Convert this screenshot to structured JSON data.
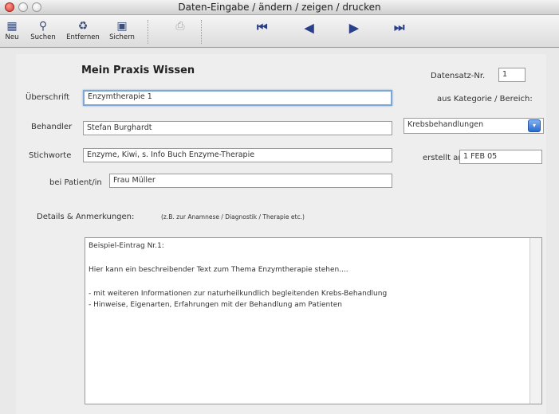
{
  "window": {
    "title": "Daten-Eingabe / ändern / zeigen / drucken"
  },
  "toolbar": {
    "new": "Neu",
    "search": "Suchen",
    "remove": "Entfernen",
    "save": "Sichern"
  },
  "form": {
    "heading": "Mein Praxis Wissen",
    "record_label": "Datensatz-Nr.",
    "record_value": "1",
    "title_label": "Überschrift",
    "title_value": "Enzymtherapie 1",
    "category_label": "aus Kategorie / Bereich:",
    "category_value": "Krebsbehandlungen",
    "practitioner_label": "Behandler",
    "practitioner_value": "Stefan Burghardt",
    "keywords_label": "Stichworte",
    "keywords_value": "Enzyme, Kiwi, s. Info Buch Enzyme-Therapie",
    "created_label": "erstellt am",
    "created_value": "1 FEB 05",
    "patient_label": "bei Patient/in",
    "patient_value": "Frau Müller",
    "details_label": "Details & Anmerkungen:",
    "details_hint": "(z.B. zur Anamnese / Diagnostik / Therapie etc.)",
    "details_lines": [
      "Beispiel-Eintrag  Nr.1:",
      "Hier kann ein beschreibender Text zum Thema Enzymtherapie stehen....",
      "- mit weiteren Informationen zur naturheilkundlich begleitenden Krebs-Behandlung",
      "- Hinweise, Eigenarten, Erfahrungen mit der Behandlung am Patienten"
    ]
  }
}
